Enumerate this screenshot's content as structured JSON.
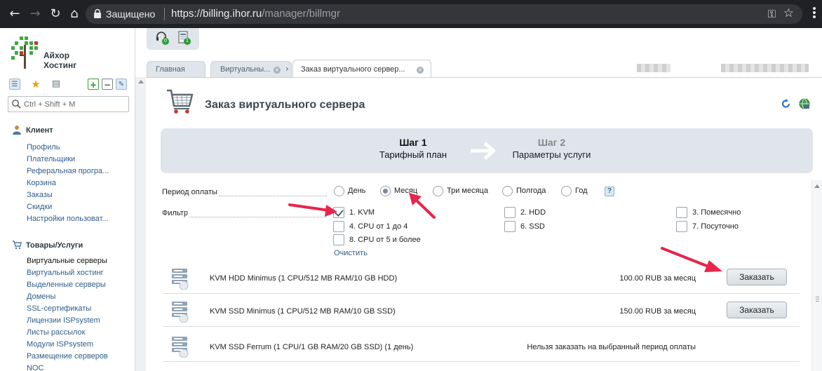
{
  "browser": {
    "secure_label": "Защищено",
    "url_host": "https://billing.ihor.ru",
    "url_path": "/manager/billmgr"
  },
  "logo": {
    "line1": "Айхор",
    "line2": "Хостинг"
  },
  "sidebar": {
    "search_placeholder": "Ctrl + Shift + M",
    "sections": [
      {
        "title": "Клиент",
        "items": [
          "Профиль",
          "Плательщики",
          "Реферальная програ...",
          "Корзина",
          "Заказы",
          "Скидки",
          "Настройки пользоват..."
        ]
      },
      {
        "title": "Товары/Услуги",
        "items": [
          "Виртуальные серверы",
          "Виртуальный хостинг",
          "Выделенные серверы",
          "Домены",
          "SSL-сертификаты",
          "Лицензии ISPsystem",
          "Листы рассылок",
          "Модули ISPsystem",
          "Размещение серверов",
          "NOC"
        ]
      }
    ]
  },
  "top_icons": {
    "support_count": "0",
    "tasks_count": "1"
  },
  "tabs": [
    {
      "label": "Главная"
    },
    {
      "label": "Виртуальны..."
    },
    {
      "label": "Заказ виртуального сервер..."
    }
  ],
  "page": {
    "title": "Заказ виртуального сервера",
    "steps": [
      {
        "number": "Шаг 1",
        "label": "Тарифный план"
      },
      {
        "number": "Шаг 2",
        "label": "Параметры услуги"
      }
    ],
    "period_label": "Период оплаты",
    "periods": [
      "День",
      "Месяц",
      "Три месяца",
      "Полгода",
      "Год"
    ],
    "selected_period": "Месяц",
    "help": "?",
    "filter_label": "Фильтр",
    "filters": [
      {
        "label": "1. KVM",
        "checked": true
      },
      {
        "label": "2. HDD",
        "checked": false
      },
      {
        "label": "3. Помесячно",
        "checked": false
      },
      {
        "label": "4. CPU от 1 до 4",
        "checked": false
      },
      {
        "label": "6. SSD",
        "checked": false
      },
      {
        "label": "7. Посуточно",
        "checked": false
      },
      {
        "label": "8. CPU от 5 и более",
        "checked": false
      }
    ],
    "clear_label": "Очистить",
    "products": [
      {
        "name": "KVM HDD Minimus (1 CPU/512 MB RAM/10 GB HDD)",
        "price": "100.00 RUB за месяц",
        "button": "Заказать"
      },
      {
        "name": "KVM SSD Minimus (1 CPU/512 MB RAM/10 GB SSD)",
        "price": "150.00 RUB за месяц",
        "button": "Заказать"
      },
      {
        "name": "KVM SSD Ferrum (1 CPU/1 GB RAM/20 GB SSD) (1 день)",
        "note": "Нельзя заказать на выбранный период оплаты"
      }
    ]
  },
  "colors": {
    "chrome_bg": "#202124",
    "panel_bg": "#dfe5ea",
    "link": "#2f5d8a",
    "annotation_arrow": "#e8254a"
  },
  "icons": [
    "back-arrow-icon",
    "forward-arrow-icon",
    "reload-icon",
    "home-icon",
    "lock-icon",
    "key-icon",
    "bookmark-star-icon",
    "cart-icon",
    "refresh-icon",
    "globe-icon",
    "server-icon",
    "headset-icon",
    "tasks-icon"
  ]
}
